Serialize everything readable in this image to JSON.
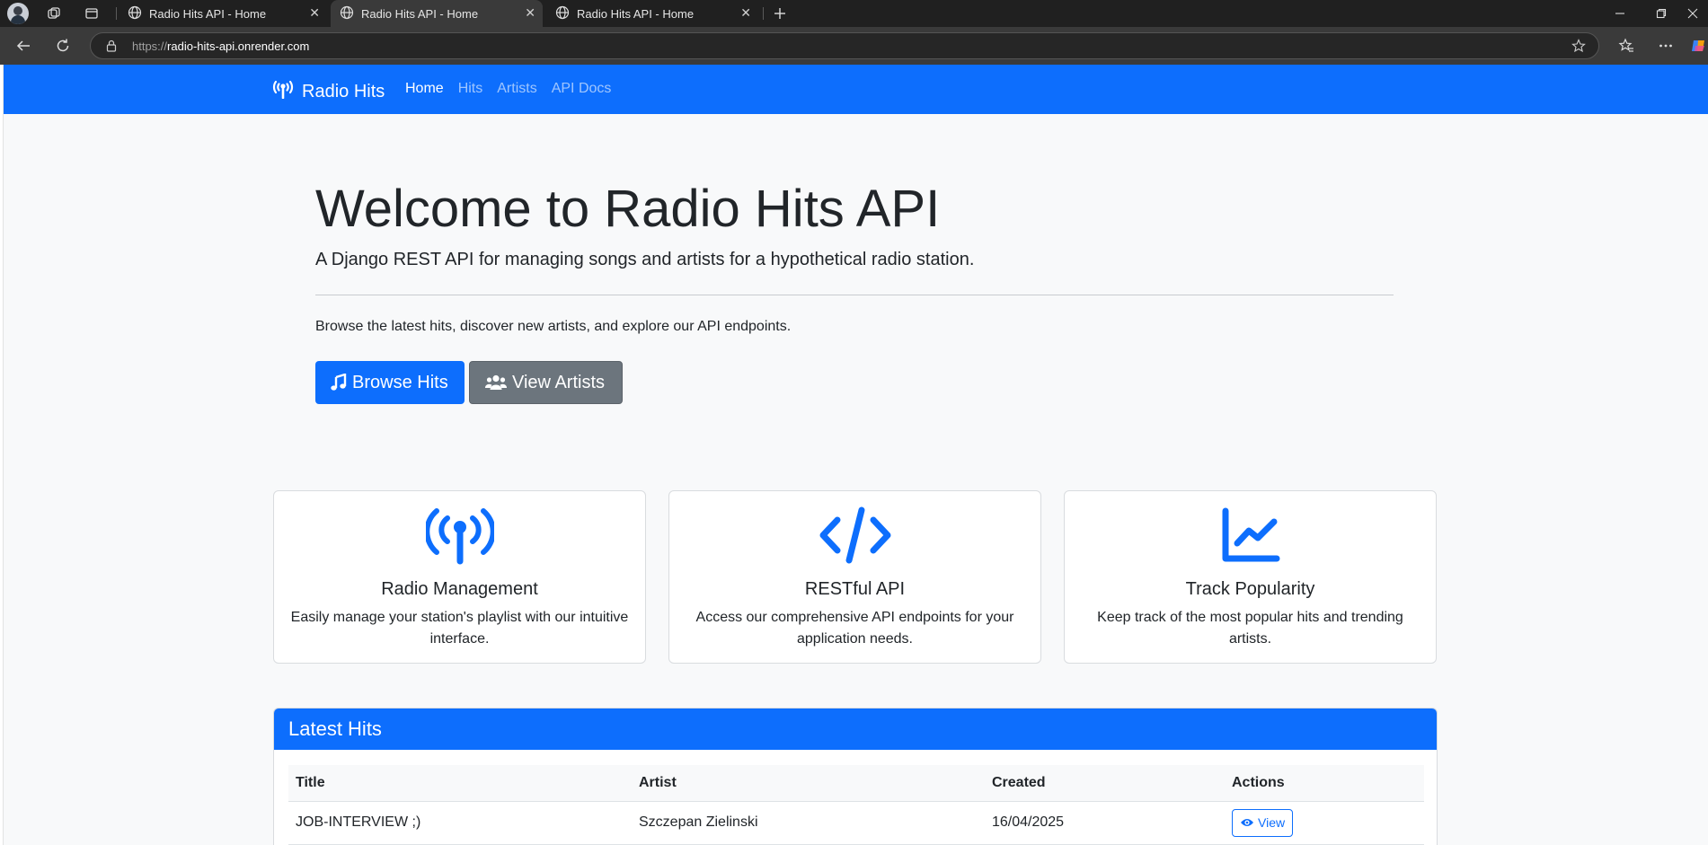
{
  "browser": {
    "tabs": [
      {
        "title": "Radio Hits API - Home"
      },
      {
        "title": "Radio Hits API - Home"
      },
      {
        "title": "Radio Hits API - Home"
      }
    ],
    "url_scheme": "https://",
    "url_host": "radio-hits-api.onrender.com"
  },
  "nav": {
    "brand": "Radio Hits",
    "links": [
      {
        "label": "Home",
        "active": true
      },
      {
        "label": "Hits",
        "active": false
      },
      {
        "label": "Artists",
        "active": false
      },
      {
        "label": "API Docs",
        "active": false
      }
    ]
  },
  "hero": {
    "title": "Welcome to Radio Hits API",
    "lead": "A Django REST API for managing songs and artists for a hypothetical radio station.",
    "text": "Browse the latest hits, discover new artists, and explore our API endpoints.",
    "primary_button": "Browse Hits",
    "secondary_button": "View Artists"
  },
  "features": [
    {
      "icon": "broadcast-tower-icon",
      "title": "Radio Management",
      "text": "Easily manage your station's playlist with our intuitive interface."
    },
    {
      "icon": "code-icon",
      "title": "RESTful API",
      "text": "Access our comprehensive API endpoints for your application needs."
    },
    {
      "icon": "chart-line-icon",
      "title": "Track Popularity",
      "text": "Keep track of the most popular hits and trending artists."
    }
  ],
  "latest_hits": {
    "heading": "Latest Hits",
    "columns": [
      "Title",
      "Artist",
      "Created",
      "Actions"
    ],
    "rows": [
      {
        "title": "JOB-INTERVIEW ;)",
        "artist": "Szczepan Zielinski",
        "created": "16/04/2025",
        "action": "View"
      }
    ]
  },
  "colors": {
    "primary": "#0d6efd",
    "secondary": "#6c757d",
    "browser_dark": "#202020"
  }
}
